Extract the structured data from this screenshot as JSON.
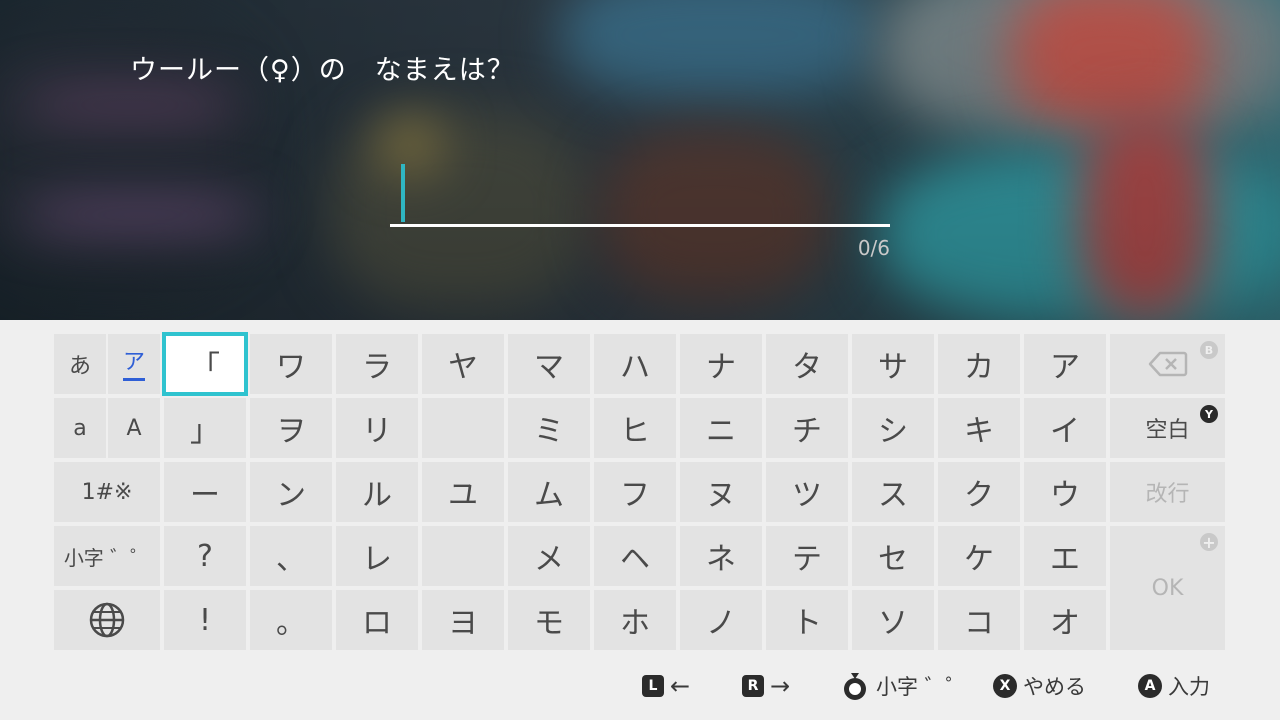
{
  "header": {
    "title": "ウールー（♀）の　なまえは？",
    "input_value": "",
    "counter": "0/6"
  },
  "modes": {
    "hiragana": "あ",
    "katakana": "ア",
    "lower_latin": "a",
    "upper_latin": "A",
    "symbols": "1#※",
    "small_dakuten": "小字 ゛゜",
    "globe": "globe-icon"
  },
  "keys": {
    "rows": [
      [
        "「",
        "ワ",
        "ラ",
        "ヤ",
        "マ",
        "ハ",
        "ナ",
        "タ",
        "サ",
        "カ",
        "ア"
      ],
      [
        "」",
        "ヲ",
        "リ",
        "",
        "ミ",
        "ヒ",
        "ニ",
        "チ",
        "シ",
        "キ",
        "イ"
      ],
      [
        "ー",
        "ン",
        "ル",
        "ユ",
        "ム",
        "フ",
        "ヌ",
        "ツ",
        "ス",
        "ク",
        "ウ"
      ],
      [
        "?",
        "、",
        "レ",
        "",
        "メ",
        "ヘ",
        "ネ",
        "テ",
        "セ",
        "ケ",
        "エ"
      ],
      [
        "!",
        "。",
        "ロ",
        "ヨ",
        "モ",
        "ホ",
        "ノ",
        "ト",
        "ソ",
        "コ",
        "オ"
      ]
    ],
    "selected": "「"
  },
  "actions": {
    "backspace_icon": "backspace-icon",
    "backspace_badge": "B",
    "space_label": "空白",
    "space_badge": "Y",
    "newline_label": "改行",
    "ok_label": "OK",
    "ok_badge": "+"
  },
  "hints": {
    "l_button": "L",
    "l_label": "←",
    "r_button": "R",
    "r_label": "→",
    "stick_label": "小字 ゛゜",
    "x_button": "X",
    "x_label": "やめる",
    "a_button": "A",
    "a_label": "入力"
  },
  "colors": {
    "accent": "#2fc3cf",
    "mode_active": "#2f5fd6",
    "key_bg": "#e3e3e3",
    "panel_bg": "#efefef"
  }
}
